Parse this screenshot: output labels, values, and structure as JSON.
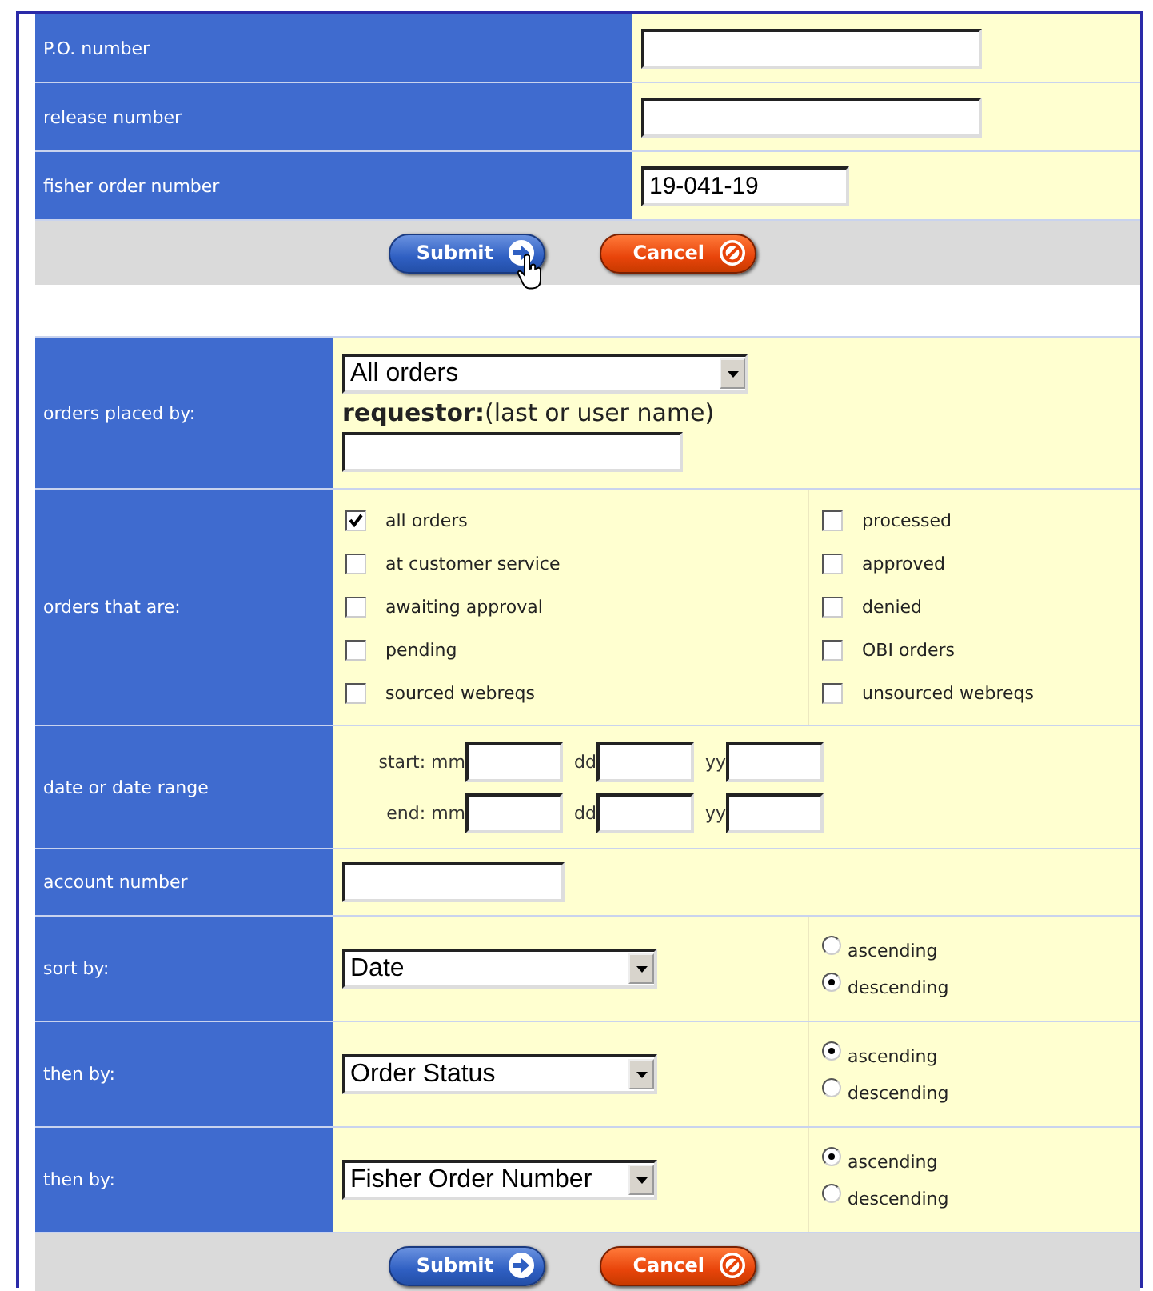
{
  "top_fields": [
    {
      "label": "P.O. number",
      "kind": "wide"
    },
    {
      "label": "release number",
      "kind": "wide"
    },
    {
      "label": "fisher order number",
      "value": "19-041-19",
      "kind": "short"
    }
  ],
  "top_buttons": [
    {
      "kind": "submit",
      "label": "Submit",
      "hovered": true
    },
    {
      "kind": "cancel",
      "label": "Cancel",
      "hovered": false
    }
  ],
  "orders_placed_by": {
    "label": "orders placed by:",
    "select": "All orders",
    "requestor_hint": "**requestor:**(last or user name)"
  },
  "order_status": {
    "label": "orders that are:",
    "columns": [
      [
        {
          "label": "all orders",
          "checked": true
        },
        {
          "label": "at customer service",
          "checked": false
        },
        {
          "label": "awaiting approval",
          "checked": false
        },
        {
          "label": "pending",
          "checked": false
        },
        {
          "label": "sourced webreqs",
          "checked": false
        }
      ],
      [
        {
          "label": "processed",
          "checked": false
        },
        {
          "label": "approved",
          "checked": false
        },
        {
          "label": "denied",
          "checked": false
        },
        {
          "label": "OBI orders",
          "checked": false
        },
        {
          "label": "unsourced webreqs",
          "checked": false
        }
      ]
    ]
  },
  "date_range": {
    "label": "date or date range",
    "rows": [
      {
        "month_label": "start: mm",
        "day_label": "dd",
        "year_label": "yy"
      },
      {
        "month_label": "end: mm",
        "day_label": "dd",
        "year_label": "yy"
      }
    ]
  },
  "account_number": {
    "label": "account number"
  },
  "sort_rows": [
    {
      "label": "sort by:",
      "select": "Date",
      "options": [
        {
          "label": "ascending",
          "selected": false
        },
        {
          "label": "descending",
          "selected": true
        }
      ]
    },
    {
      "label": "then by:",
      "select": "Order Status",
      "options": [
        {
          "label": "ascending",
          "selected": true
        },
        {
          "label": "descending",
          "selected": false
        }
      ]
    },
    {
      "label": "then by:",
      "select": "Fisher Order Number",
      "options": [
        {
          "label": "ascending",
          "selected": true
        },
        {
          "label": "descending",
          "selected": false
        }
      ]
    }
  ],
  "bottom_buttons": [
    {
      "kind": "submit",
      "label": "Submit",
      "hovered": false
    },
    {
      "kind": "cancel",
      "label": "Cancel",
      "hovered": false
    }
  ]
}
